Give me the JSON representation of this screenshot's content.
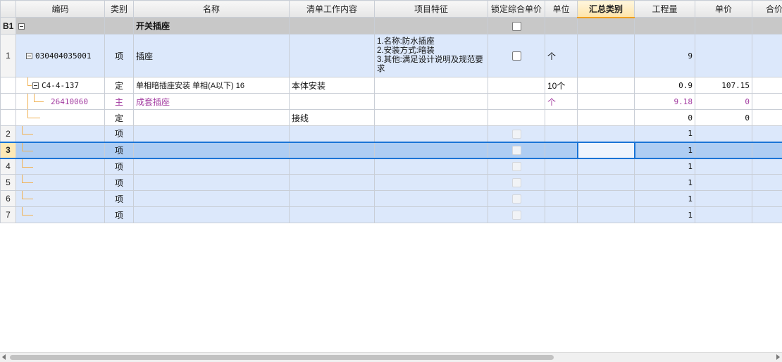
{
  "headers": {
    "code": "编码",
    "type": "类别",
    "name": "名称",
    "work": "清单工作内容",
    "feature": "项目特征",
    "lock": "锁定综合单价",
    "unit": "单位",
    "summary": "汇总类别",
    "qty": "工程量",
    "price": "单价",
    "total": "合价"
  },
  "section": {
    "id": "B1",
    "name": "开关插座"
  },
  "item1": {
    "rn": "1",
    "code": "030404035001",
    "type": "项",
    "name": "插座",
    "feature_lines": [
      "1.名称:防水插座",
      "2.安装方式:暗装",
      "3.其他:满足设计说明及规范要求"
    ],
    "unit": "个",
    "qty": "9"
  },
  "quota": {
    "code": "C4-4-137",
    "type": "定",
    "name": "单相暗插座安装 单相(A以下) 16",
    "work": "本体安装",
    "unit": "10个",
    "qty": "0.9",
    "price": "107.15"
  },
  "material": {
    "code": "26410060",
    "type": "主",
    "name": "成套插座",
    "unit": "个",
    "qty": "9.18",
    "price": "0"
  },
  "wiring": {
    "type": "定",
    "work": "接线",
    "qty": "0",
    "price": "0"
  },
  "rows": [
    {
      "rn": "2",
      "type": "项",
      "qty": "1"
    },
    {
      "rn": "3",
      "type": "项",
      "qty": "1"
    },
    {
      "rn": "4",
      "type": "项",
      "qty": "1"
    },
    {
      "rn": "5",
      "type": "项",
      "qty": "1"
    },
    {
      "rn": "6",
      "type": "项",
      "qty": "1"
    },
    {
      "rn": "7",
      "type": "项",
      "qty": "1"
    }
  ],
  "colors": {
    "accent": "#1a74d6",
    "tree_line": "#f0b255",
    "material_text": "#a23ba0",
    "row_blue": "#dce8fb"
  }
}
